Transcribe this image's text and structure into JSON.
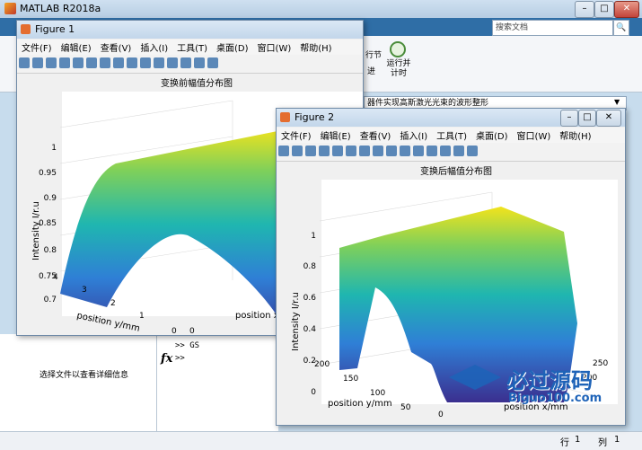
{
  "main": {
    "title": "MATLAB R2018a",
    "search_placeholder": "搜索文档",
    "ribbon_buttons": [
      "行节",
      "进",
      "运行并\n计时"
    ],
    "address": "器件实现高斯激光光束的波形整形",
    "left_panel_text": "选择文件以查看详细信息",
    "cmd_lines": [
      ">> GS",
      ">>"
    ],
    "status": {
      "row_label": "行",
      "row": "1",
      "col_label": "列",
      "col": "1"
    }
  },
  "menus": [
    "文件(F)",
    "编辑(E)",
    "查看(V)",
    "插入(I)",
    "工具(T)",
    "桌面(D)",
    "窗口(W)",
    "帮助(H)"
  ],
  "figure1": {
    "title": "Figure 1",
    "plot_title": "变换前幅值分布图",
    "zlabel": "Intensity I/r.u",
    "ylabel": "position y/mm",
    "xlabel": "position x/",
    "zticks": [
      "0.7",
      "0.75",
      "0.8",
      "0.85",
      "0.9",
      "0.95",
      "1"
    ],
    "yticks": [
      "0",
      "1",
      "2",
      "3",
      "4"
    ],
    "xticks": [
      "0"
    ]
  },
  "figure2": {
    "title": "Figure 2",
    "plot_title": "变换后幅值分布图",
    "zlabel": "Intensity I/r.u",
    "ylabel": "position y/mm",
    "xlabel": "position x/mm",
    "zticks": [
      "0",
      "0.2",
      "0.4",
      "0.6",
      "0.8",
      "1"
    ],
    "yticks": [
      "0",
      "50",
      "100",
      "150",
      "200"
    ],
    "xticks": [
      "200",
      "250"
    ]
  },
  "watermark": {
    "text": "必过源码",
    "url": "Biguo100.com"
  }
}
